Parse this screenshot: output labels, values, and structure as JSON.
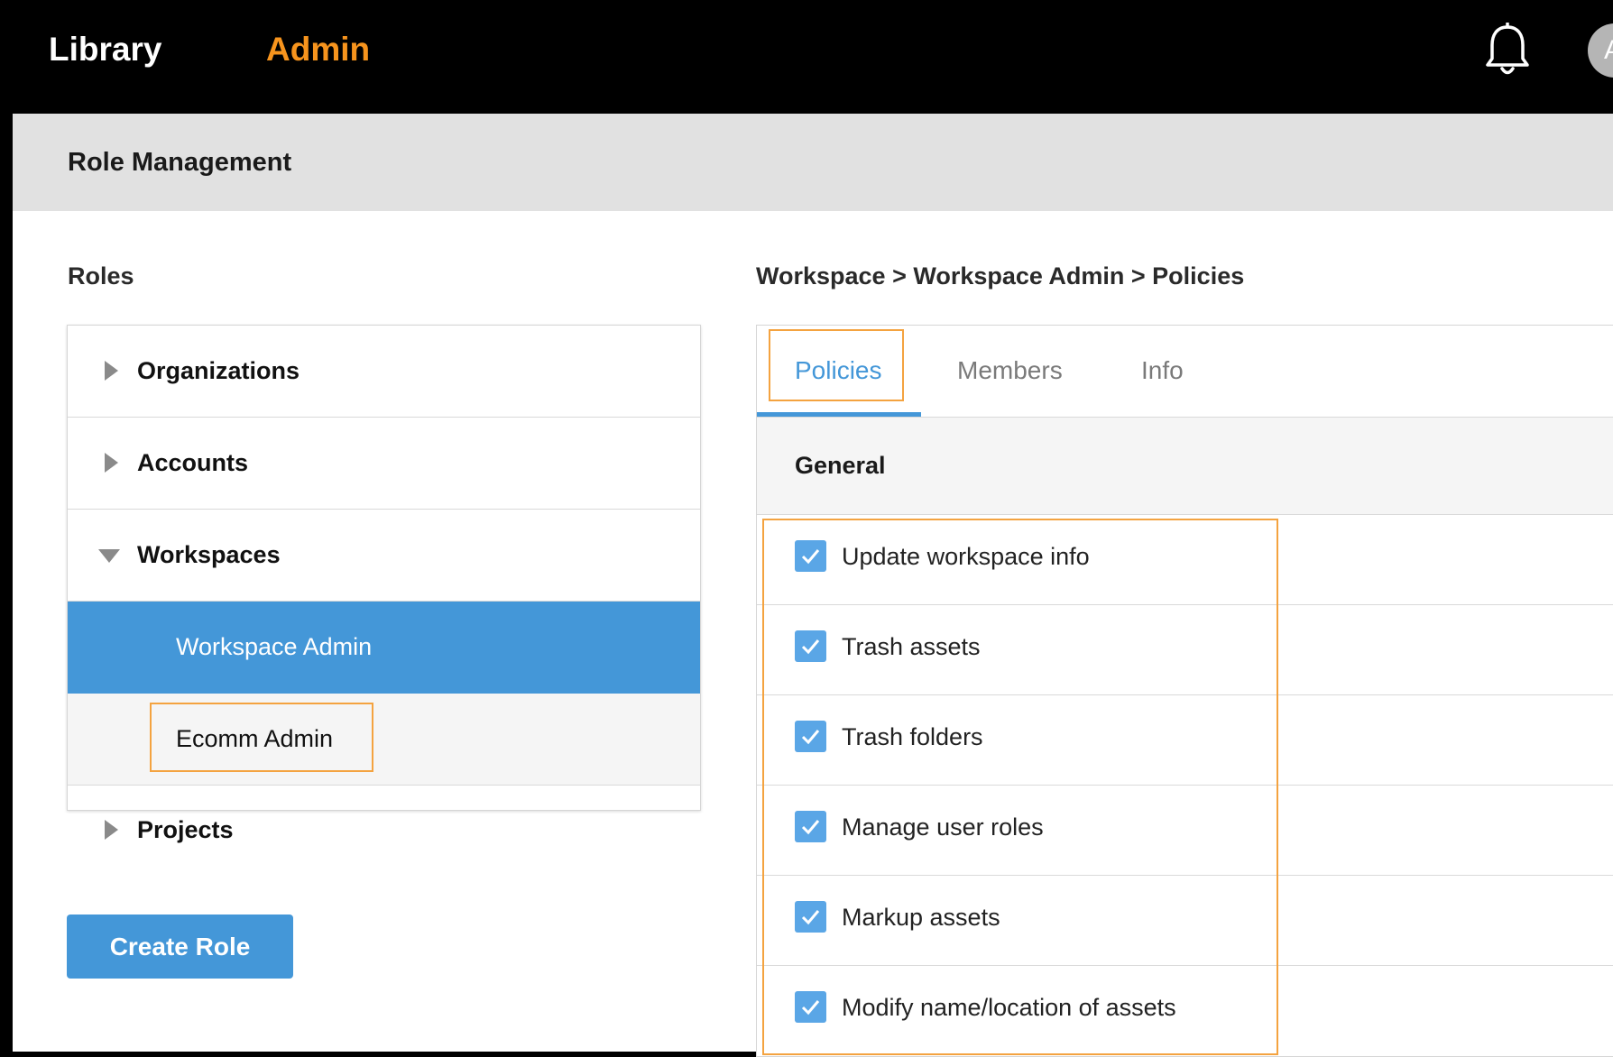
{
  "topnav": {
    "library": "Library",
    "admin": "Admin",
    "avatar_initial": "A"
  },
  "accent_color": "#f7941d",
  "primary_color": "#4497d8",
  "panel": {
    "title": "Role Management"
  },
  "roles": {
    "title": "Roles",
    "items": [
      {
        "label": "Organizations",
        "expanded": false
      },
      {
        "label": "Accounts",
        "expanded": false
      },
      {
        "label": "Workspaces",
        "expanded": true
      },
      {
        "label": "Workspace Admin",
        "selected": true
      },
      {
        "label": "Ecomm Admin",
        "selected": false
      },
      {
        "label": "Projects",
        "expanded": false
      }
    ],
    "create_button": "Create Role"
  },
  "detail": {
    "breadcrumb": "Workspace > Workspace Admin > Policies",
    "tabs": [
      {
        "label": "Policies",
        "active": true
      },
      {
        "label": "Members",
        "active": false
      },
      {
        "label": "Info",
        "active": false
      }
    ],
    "group": "General",
    "policies": [
      {
        "label": "Update workspace info",
        "checked": true
      },
      {
        "label": "Trash assets",
        "checked": true
      },
      {
        "label": "Trash folders",
        "checked": true
      },
      {
        "label": "Manage user roles",
        "checked": true
      },
      {
        "label": "Markup assets",
        "checked": true
      },
      {
        "label": "Modify name/location of assets",
        "checked": true
      }
    ]
  }
}
